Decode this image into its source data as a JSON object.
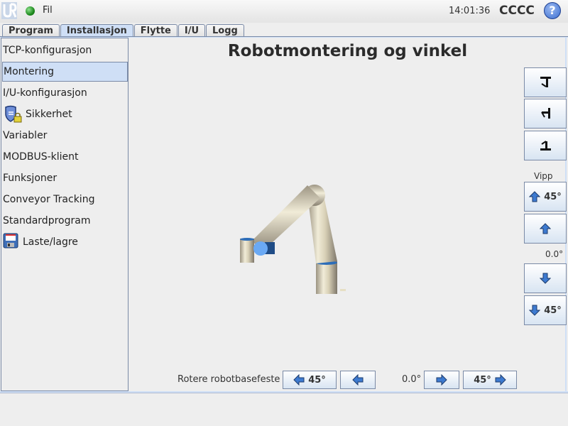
{
  "topbar": {
    "menu_label": "Fil",
    "clock": "14:01:36",
    "robot_name": "CCCC",
    "help_label": "?"
  },
  "tabs": [
    {
      "label": "Program",
      "active": false
    },
    {
      "label": "Installasjon",
      "active": true
    },
    {
      "label": "Flytte",
      "active": false
    },
    {
      "label": "I/U",
      "active": false
    },
    {
      "label": "Logg",
      "active": false
    }
  ],
  "sidebar": {
    "items": [
      {
        "label": "TCP-konfigurasjon"
      },
      {
        "label": "Montering",
        "selected": true
      },
      {
        "label": "I/U-konfigurasjon"
      },
      {
        "label": "Sikkerhet",
        "icon": "shield-lock-icon"
      },
      {
        "label": "Variabler"
      },
      {
        "label": "MODBUS-klient"
      },
      {
        "label": "Funksjoner"
      },
      {
        "label": "Conveyor Tracking"
      },
      {
        "label": "Standardprogram"
      },
      {
        "label": "Laste/lagre",
        "icon": "floppy-disk-icon"
      }
    ]
  },
  "main": {
    "title": "Robotmontering og vinkel",
    "tilt": {
      "label": "Vipp",
      "up45_label": "45°",
      "down45_label": "45°",
      "value": "0.0°"
    },
    "rotate": {
      "label": "Rotere robotbasefeste",
      "left45_label": "45°",
      "right45_label": "45°",
      "value": "0.0°"
    },
    "mount_views": [
      {
        "name": "ceiling-mount"
      },
      {
        "name": "wall-mount"
      },
      {
        "name": "floor-mount"
      }
    ]
  }
}
